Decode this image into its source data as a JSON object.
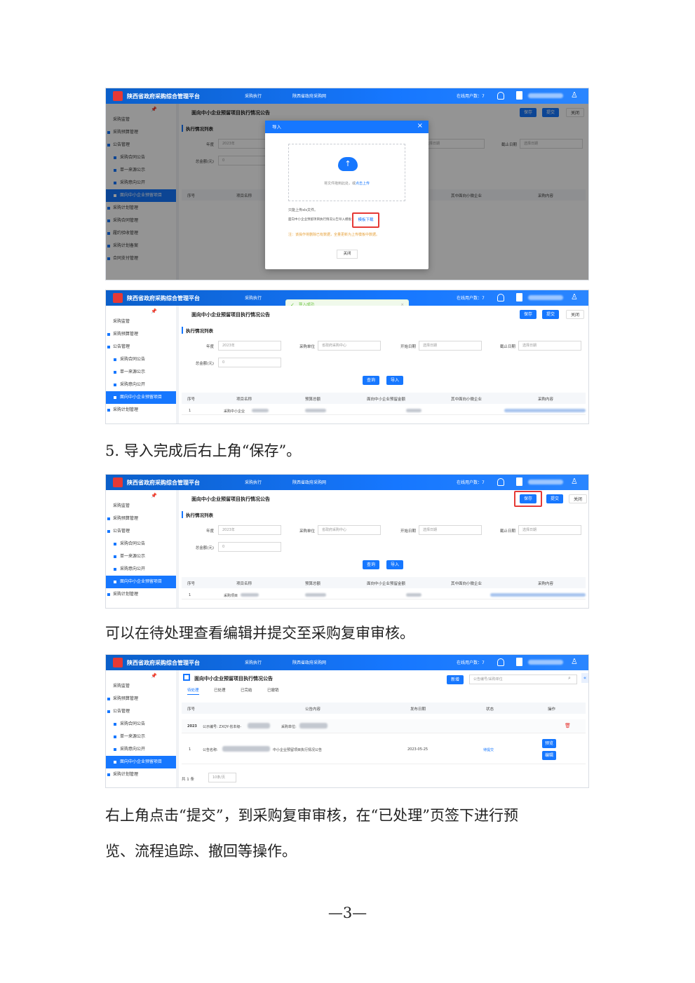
{
  "app": {
    "title": "陕西省政府采购综合管理平台",
    "nav1": "采购执行",
    "nav2": "陕西省政府采购网",
    "online": "在线用户数：7"
  },
  "sidebar": {
    "pin": "📌",
    "items": [
      "采购监管",
      "采购预算管理",
      "公告管理",
      "采购合同公告",
      "单一来源公示",
      "采购意向公开",
      "面向中小企业预留项目",
      "采购计划管理",
      "采购合同管理",
      "履约验收管理",
      "采购计划备案",
      "合同支付管理"
    ]
  },
  "page": {
    "title": "面向中小企业预留项目执行情况公告",
    "section": "执行情况列表",
    "save": "保存",
    "submit": "提交",
    "close": "关闭",
    "query": "查询",
    "import": "导入"
  },
  "form": {
    "year_label": "年度",
    "year_val": "2023年",
    "unit_label": "采购单位",
    "unit_val": "省政府采购中心",
    "start_label": "开始日期",
    "start_ph": "选择日期",
    "end_label": "截止日期",
    "end_ph": "选择日期",
    "amount_label": "总金额(元)",
    "amount_val": "0"
  },
  "table": {
    "headers": [
      "序号",
      "项目名称",
      "预算总额",
      "面向中小企业预留金额",
      "其中面向小微企业",
      "采购内容"
    ],
    "row1_no": "1",
    "row1_name": "采购中小企业",
    "row1_name3": "采购项目"
  },
  "dialog": {
    "title": "导入",
    "close_x": "×",
    "drop_text": "将文件拖到此处，或",
    "drop_link": "点击上传",
    "tip1": "只能上传xls文件。",
    "tip2": "面向中小企业预留项目执行情况公告导入模板：",
    "template": "模板下载",
    "warn": "注：该操作将删除已有数据，全量更新为上传模板中数据。",
    "close_btn": "关闭"
  },
  "toast": {
    "text": "导入成功",
    "x": "×"
  },
  "paras": {
    "p1": "5. 导入完成后右上角“保存”。",
    "p2": "可以在待处理查看编辑并提交至采购复审审核。",
    "p3a": "右上角点击“提交”，到采购复审审核，在“已处理”页签下进行预",
    "p3b": "览、流程追踪、撤回等操作。"
  },
  "list": {
    "title": "面向中小企业预留项目执行情况公告",
    "add": "新增",
    "search_ph": "公告编号/采购单位",
    "tabs": [
      "待处理",
      "已处理",
      "已完结",
      "已撤销"
    ],
    "headers": [
      "序号",
      "公告内容",
      "发布日期",
      "状态",
      "操作"
    ],
    "g_year": "2023",
    "g_code": "公示编号: ZXQY-省本级-",
    "g_unit": "采购单位:",
    "r_no": "1",
    "r_name": "公告名称:",
    "r_name2": "中小企业预留项目执行情况公告",
    "r_date": "2023-05-25",
    "r_status": "待提交",
    "op1": "预览",
    "op2": "编辑",
    "total": "共 1 条",
    "pagesize": "10条/页"
  },
  "page_number": "—3—"
}
